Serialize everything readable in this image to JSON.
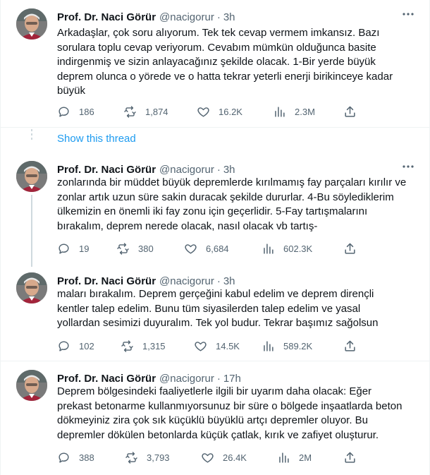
{
  "tweets": [
    {
      "name": "Prof. Dr. Naci Görür",
      "handle": "@nacigorur",
      "dot": "·",
      "time": "3h",
      "lines": [
        "Arkadaşlar, çok soru alıyorum. Tek tek cevap vermem imkansız. Bazı",
        "sorulara toplu cevap veriyorum. Cevabım mümkün olduğunca basite",
        "indirgenmiş ve sizin anlayacağınız şekilde olacak. 1-Bir yerde büyük",
        "deprem olunca o yörede ve o hatta tekrar yeterli enerji birikinceye kadar",
        "büyük"
      ],
      "replies": "186",
      "retweets": "1,874",
      "likes": "16.2K",
      "views": "2.3M"
    },
    {
      "name": "Prof. Dr. Naci Görür",
      "handle": "@nacigorur",
      "dot": "·",
      "time": "3h",
      "lines": [
        "zonlarında bir müddet büyük depremlerde kırılmamış fay parçaları kırılır ve",
        "zonlar artık uzun süre sakin duracak şekilde dururlar. 4-Bu söylediklerim",
        "ülkemizin en önemli iki fay zonu için geçerlidir. 5-Fay tartışmalarını",
        "bırakalım, deprem nerede olacak, nasıl olacak vb tartış-"
      ],
      "replies": "19",
      "retweets": "380",
      "likes": "6,684",
      "views": "602.3K"
    },
    {
      "name": "Prof. Dr. Naci Görür",
      "handle": "@nacigorur",
      "dot": "·",
      "time": "3h",
      "lines": [
        "maları bırakalım. Deprem gerçeğini kabul edelim ve deprem dirençli",
        "kentler talep edelim. Bunu tüm siyasilerden talep edelim ve yasal",
        "yollardan sesimizi duyuralım. Tek yol budur. Tekrar başımız sağolsun"
      ],
      "replies": "102",
      "retweets": "1,315",
      "likes": "14.5K",
      "views": "589.2K"
    },
    {
      "name": "Prof. Dr. Naci Görür",
      "handle": "@nacigorur",
      "dot": "·",
      "time": "17h",
      "lines": [
        "Deprem bölgesindeki faaliyetlerle ilgili bir uyarım daha olacak: Eğer",
        "prekast betonarme kullanmıyorsunuz bir süre o bölgede inşaatlarda beton",
        "dökmeyiniz zira çok sık küçüklü büyüklü artçı depremler oluyor. Bu",
        "depremler dökülen betonlarda küçük çatlak, kırık ve zafiyet oluşturur."
      ],
      "replies": "388",
      "retweets": "3,793",
      "likes": "26.4K",
      "views": "2M"
    }
  ],
  "show_thread_label": "Show this thread",
  "colors": {
    "link": "#1d9bf0",
    "muted": "#536471",
    "text": "#0f1419",
    "thread_line": "#cfd9de"
  },
  "icons": {
    "reply": "reply-icon",
    "retweet": "retweet-icon",
    "like": "heart-icon",
    "views": "views-icon",
    "share": "share-icon",
    "more": "more-icon"
  }
}
